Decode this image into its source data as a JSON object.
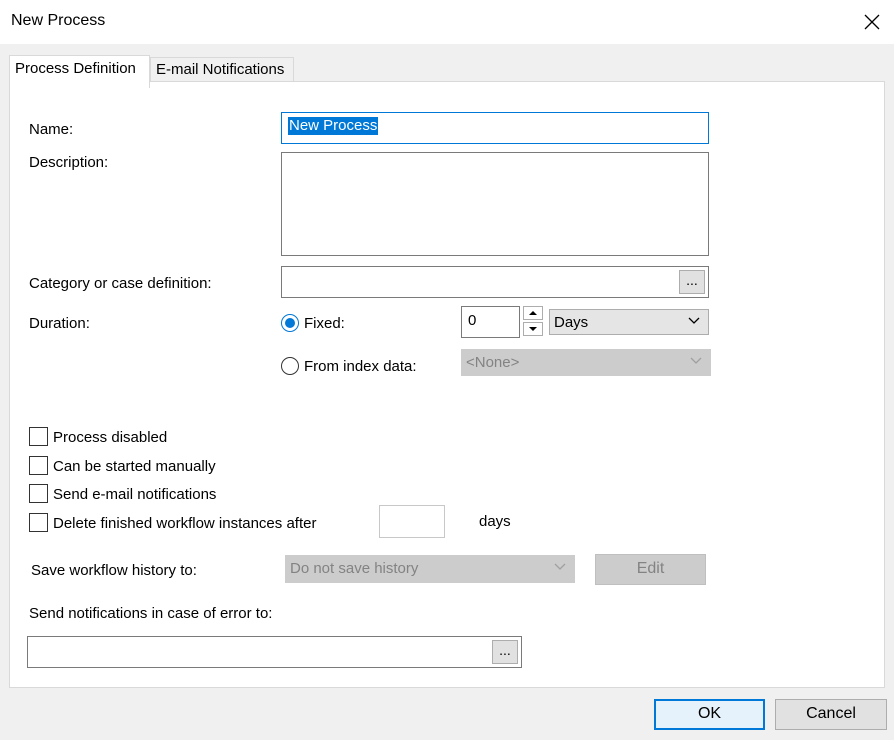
{
  "window": {
    "title": "New Process"
  },
  "tabs": [
    {
      "label": "Process Definition"
    },
    {
      "label": "E-mail Notifications"
    }
  ],
  "form": {
    "name_label": "Name:",
    "name_value": "New Process",
    "description_label": "Description:",
    "description_value": "",
    "category_label": "Category or case definition:",
    "category_value": "",
    "browse_label": "...",
    "duration_label": "Duration:",
    "fixed_label": "Fixed:",
    "fixed_selected": true,
    "fixed_value": "0",
    "unit_value": "Days",
    "index_label": "From index data:",
    "index_value": "<None>",
    "options": [
      {
        "label": "Process disabled",
        "checked": false
      },
      {
        "label": "Can be started manually",
        "checked": false
      },
      {
        "label": "Send e-mail notifications",
        "checked": false
      },
      {
        "label": "Delete finished workflow instances after",
        "checked": false
      }
    ],
    "days_value": "",
    "days_label": "days",
    "history_label": "Save workflow history to:",
    "history_value": "Do not save history",
    "edit_label": "Edit",
    "error_label": "Send notifications in case of error to:",
    "error_value": "",
    "error_browse_label": "..."
  },
  "footer": {
    "ok_label": "OK",
    "cancel_label": "Cancel"
  },
  "colors": {
    "accent": "#0078d7",
    "panel": "#ffffff",
    "chrome": "#f0f0f0"
  }
}
